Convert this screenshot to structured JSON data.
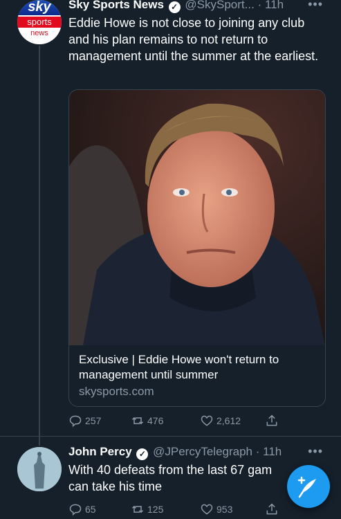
{
  "tweet1": {
    "avatar_top": "sky",
    "avatar_mid": "sports",
    "avatar_bottom": "news",
    "name": "Sky Sports News",
    "handle": "@SkySport...",
    "time": "· 11h",
    "more": "•••",
    "text": "Eddie Howe is not close to joining any club and his plan remains to not return to management until the summer at the earliest.",
    "card": {
      "title": "Exclusive | Eddie Howe won't return to management until summer",
      "domain": "skysports.com"
    },
    "replies": "257",
    "retweets": "476",
    "likes": "2,612"
  },
  "tweet2": {
    "name": "John Percy",
    "handle": "@JPercyTelegraph",
    "time": "· 11h",
    "more": "•••",
    "text": "With 40 defeats from the last 67 gam",
    "text_line2": "can take his time",
    "replies": "65",
    "retweets": "125",
    "likes": "953"
  },
  "colors": {
    "background": "#15202b",
    "accent": "#1d9bf0",
    "muted": "#8b98a5",
    "sky_red": "#e10a1e"
  },
  "icons": {
    "reply": "reply-icon",
    "retweet": "retweet-icon",
    "like": "heart-icon",
    "share": "share-icon",
    "compose": "compose-tweet-icon",
    "verified": "verified-badge-icon"
  }
}
